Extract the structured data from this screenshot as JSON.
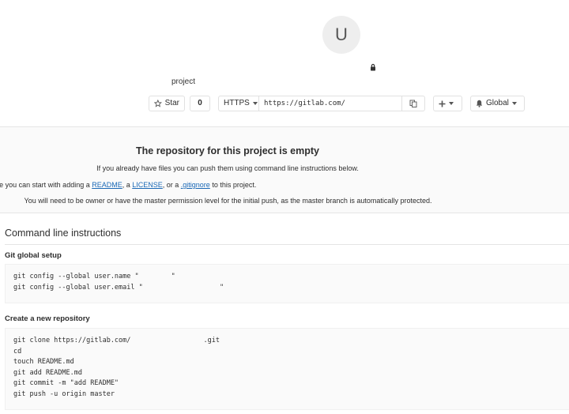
{
  "project": {
    "avatar_letter": "U",
    "name": "project"
  },
  "toolbar": {
    "star_label": "Star",
    "star_count": "0",
    "protocol_label": "HTTPS",
    "clone_url": "https://gitlab.com/",
    "notification_label": "Global"
  },
  "empty": {
    "title": "The repository for this project is empty",
    "line1": "If you already have files you can push them using command line instructions below.",
    "line2_prefix": "Otherwise you can start with adding a ",
    "readme_link": "README",
    "sep1": ", a ",
    "license_link": "LICENSE",
    "sep2": ", or a ",
    "gitignore_link": ".gitignore",
    "line2_suffix": " to this project.",
    "line3": "You will need to be owner or have the master permission level for the initial push, as the master branch is automatically protected."
  },
  "instructions": {
    "title": "Command line instructions",
    "global_setup_title": "Git global setup",
    "global_setup_code": "git config --global user.name \"        \"\ngit config --global user.email \"                   \"",
    "new_repo_title": "Create a new repository",
    "new_repo_code": "git clone https://gitlab.com/                  .git\ncd\ntouch README.md\ngit add README.md\ngit commit -m \"add README\"\ngit push -u origin master"
  },
  "colors": {
    "link": "#1b69b6",
    "panel_bg": "#fafafa",
    "border": "#e1e1e1"
  },
  "icons": {
    "star": "star-icon",
    "lock": "lock-icon",
    "copy": "clipboard-icon",
    "plus": "plus-icon",
    "bell": "bell-icon",
    "caret": "chevron-down-icon"
  }
}
